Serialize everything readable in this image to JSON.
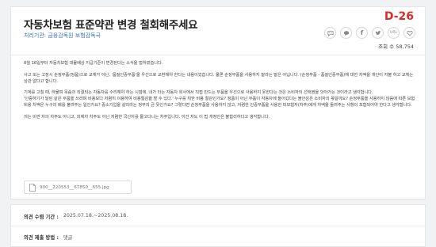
{
  "header": {
    "title": "자동차보험 표준약관 변경 철회해주세요",
    "dday": "D-26",
    "org_label": "처리기관:",
    "org_value": "금융감독원 보험감독국",
    "views_label": "조회 수",
    "views_value": "58,754"
  },
  "share_buttons": [
    {
      "name": "comment-share-button",
      "icon": "speech-bubble-icon",
      "text": ""
    },
    {
      "name": "kakao-share-button",
      "icon": "chat-icon",
      "text": ""
    },
    {
      "name": "facebook-share-button",
      "icon": "facebook-icon",
      "text": "f"
    },
    {
      "name": "twitter-share-button",
      "icon": "twitter-icon",
      "text": ""
    },
    {
      "name": "url-share-button",
      "icon": "link-icon",
      "text": "URL"
    },
    {
      "name": "heart-button",
      "icon": "heart-icon",
      "text": ""
    }
  ],
  "body": {
    "p1": "8월 16일부터 자동차보험 대물배상 지급기준이 변경된다는 소식을 접하였습니다.",
    "p2": "사고 또는 고장시 순정부품(정품)으로 교체가 아닌, '품질인증부품'을 우선으로 교환해야 한다는 내용이었습니다. 물론 순정부품을 사용하지 말라는 말은 아닙니다. (순정부품 - 품질인증부품)에 대한 차액을 개인이 지불 하고 교체는 상관 없다고 합니다.",
    "p3": "기계를 고칠 때, 하물며 목숨과 직결되는 자동차를 수리해야 하는 시점에, 내가 타는 자동차 회사에서 직접 만드는 부품을 우선으로 사용하지 못한다는 것은 소비자의 선택권을 앗아가는 것이라고 생각합니다.",
    "p4": "'인증하기가 달린 같은 부품을 쓰라며 비용보다 저렴히 이용하여 비용절감을 할 수 있다.' 누구를 위한 비용 절감인가요? 정품이 아닌 부품이 자동차에 들어갔다는 불안감은 소비자의 몫일까요? 순정부품을 사용하지 않음에 따른 보험비용 차액은 누구의 배를 불려주는 일인가요? 중소기업을 살리라는 정부의 큰 뜻인가요? 그렇다면 순정부품을 사용하지 않고, 저렴한 인증부품을 사용한 피보험자(차주)에게 차액을 돌려주는 사항이 포함되어야 한다고 생각합니다.",
    "p5": "저는 비싼 차의 차주도 아니고, 외제차 차주도 아닌 저렴한 국산차를 몰고다니는 차주입니다. 이건 저도 이 법 개정안은 불합리하다고 생각합니다."
  },
  "attachment": {
    "filename": "900__220553__67850__655.jpg"
  },
  "details": {
    "period_label": "의견 수렴 기간 :",
    "period_value": "2025.07.18.~2025.08.18.",
    "method_label": "의견 제출 방법 :",
    "method_value": "댓글"
  },
  "colors": {
    "accent_red": "#e02a2a",
    "link_blue": "#3a73c9",
    "background": "#f1f2f4"
  }
}
